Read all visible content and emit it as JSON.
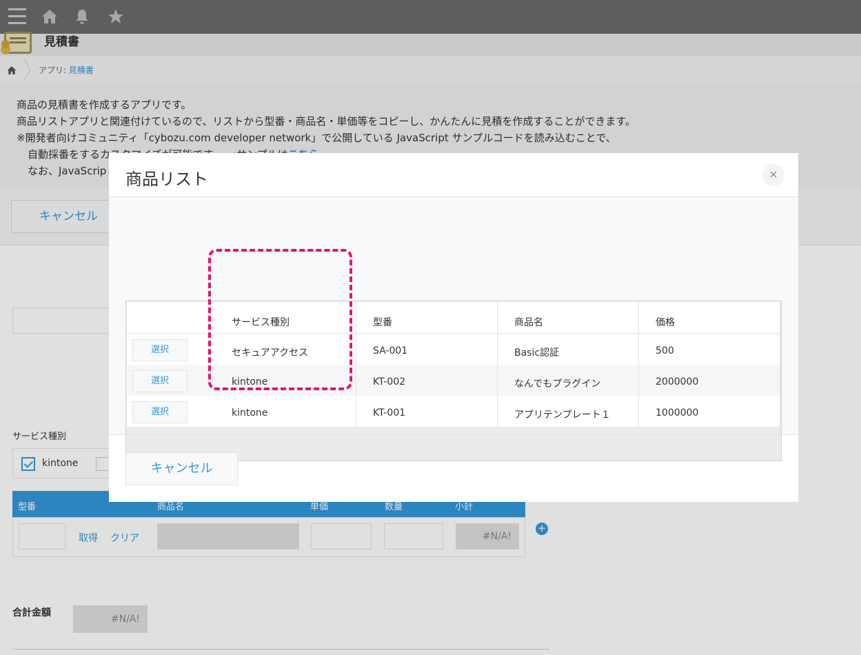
{
  "app": {
    "title": "見積書",
    "breadcrumb_prefix": "アプリ:",
    "breadcrumb_link": "見積書"
  },
  "description": {
    "line1": "商品の見積書を作成するアプリです。",
    "line2": "商品リストアプリと関連付けているので、リストから型番・商品名・単価等をコピーし、かんたんに見積を作成することができます。",
    "line3": "※開発者向けコミュニティ「cybozu.com developer network」で公開している JavaScript サンプルコードを読み込むことで、",
    "line4": "自動採番をするカスタマイズが可能です。　→サンプルは",
    "line4_link": "こちら",
    "line5": "なお、JavaScrip"
  },
  "form": {
    "cancel_label": "キャンセル",
    "service_label": "サービス種別",
    "checkbox_kintone": "kintone",
    "table_headers": [
      "型番",
      "商品名",
      "単価",
      "数量",
      "小計"
    ],
    "fetch_label": "取得",
    "clear_label": "クリア",
    "subtotal_value": "#N/A!",
    "total_label": "合計金額",
    "total_value": "#N/A!"
  },
  "modal": {
    "title": "商品リスト",
    "close_label": "×",
    "cancel_label": "キャンセル",
    "columns": [
      "サービス種別",
      "型番",
      "商品名",
      "価格"
    ],
    "select_label": "選択",
    "rows": [
      {
        "service": "セキュアアクセス",
        "model": "SA-001",
        "name": "Basic認証",
        "price": "500"
      },
      {
        "service": "kintone",
        "model": "KT-002",
        "name": "なんでもプラグイン",
        "price": "2000000"
      },
      {
        "service": "kintone",
        "model": "KT-001",
        "name": "アプリテンプレート１",
        "price": "1000000"
      }
    ]
  },
  "colors": {
    "accent": "#3498db",
    "highlight": "#e6126e",
    "topbar": "#6b6b6b"
  }
}
